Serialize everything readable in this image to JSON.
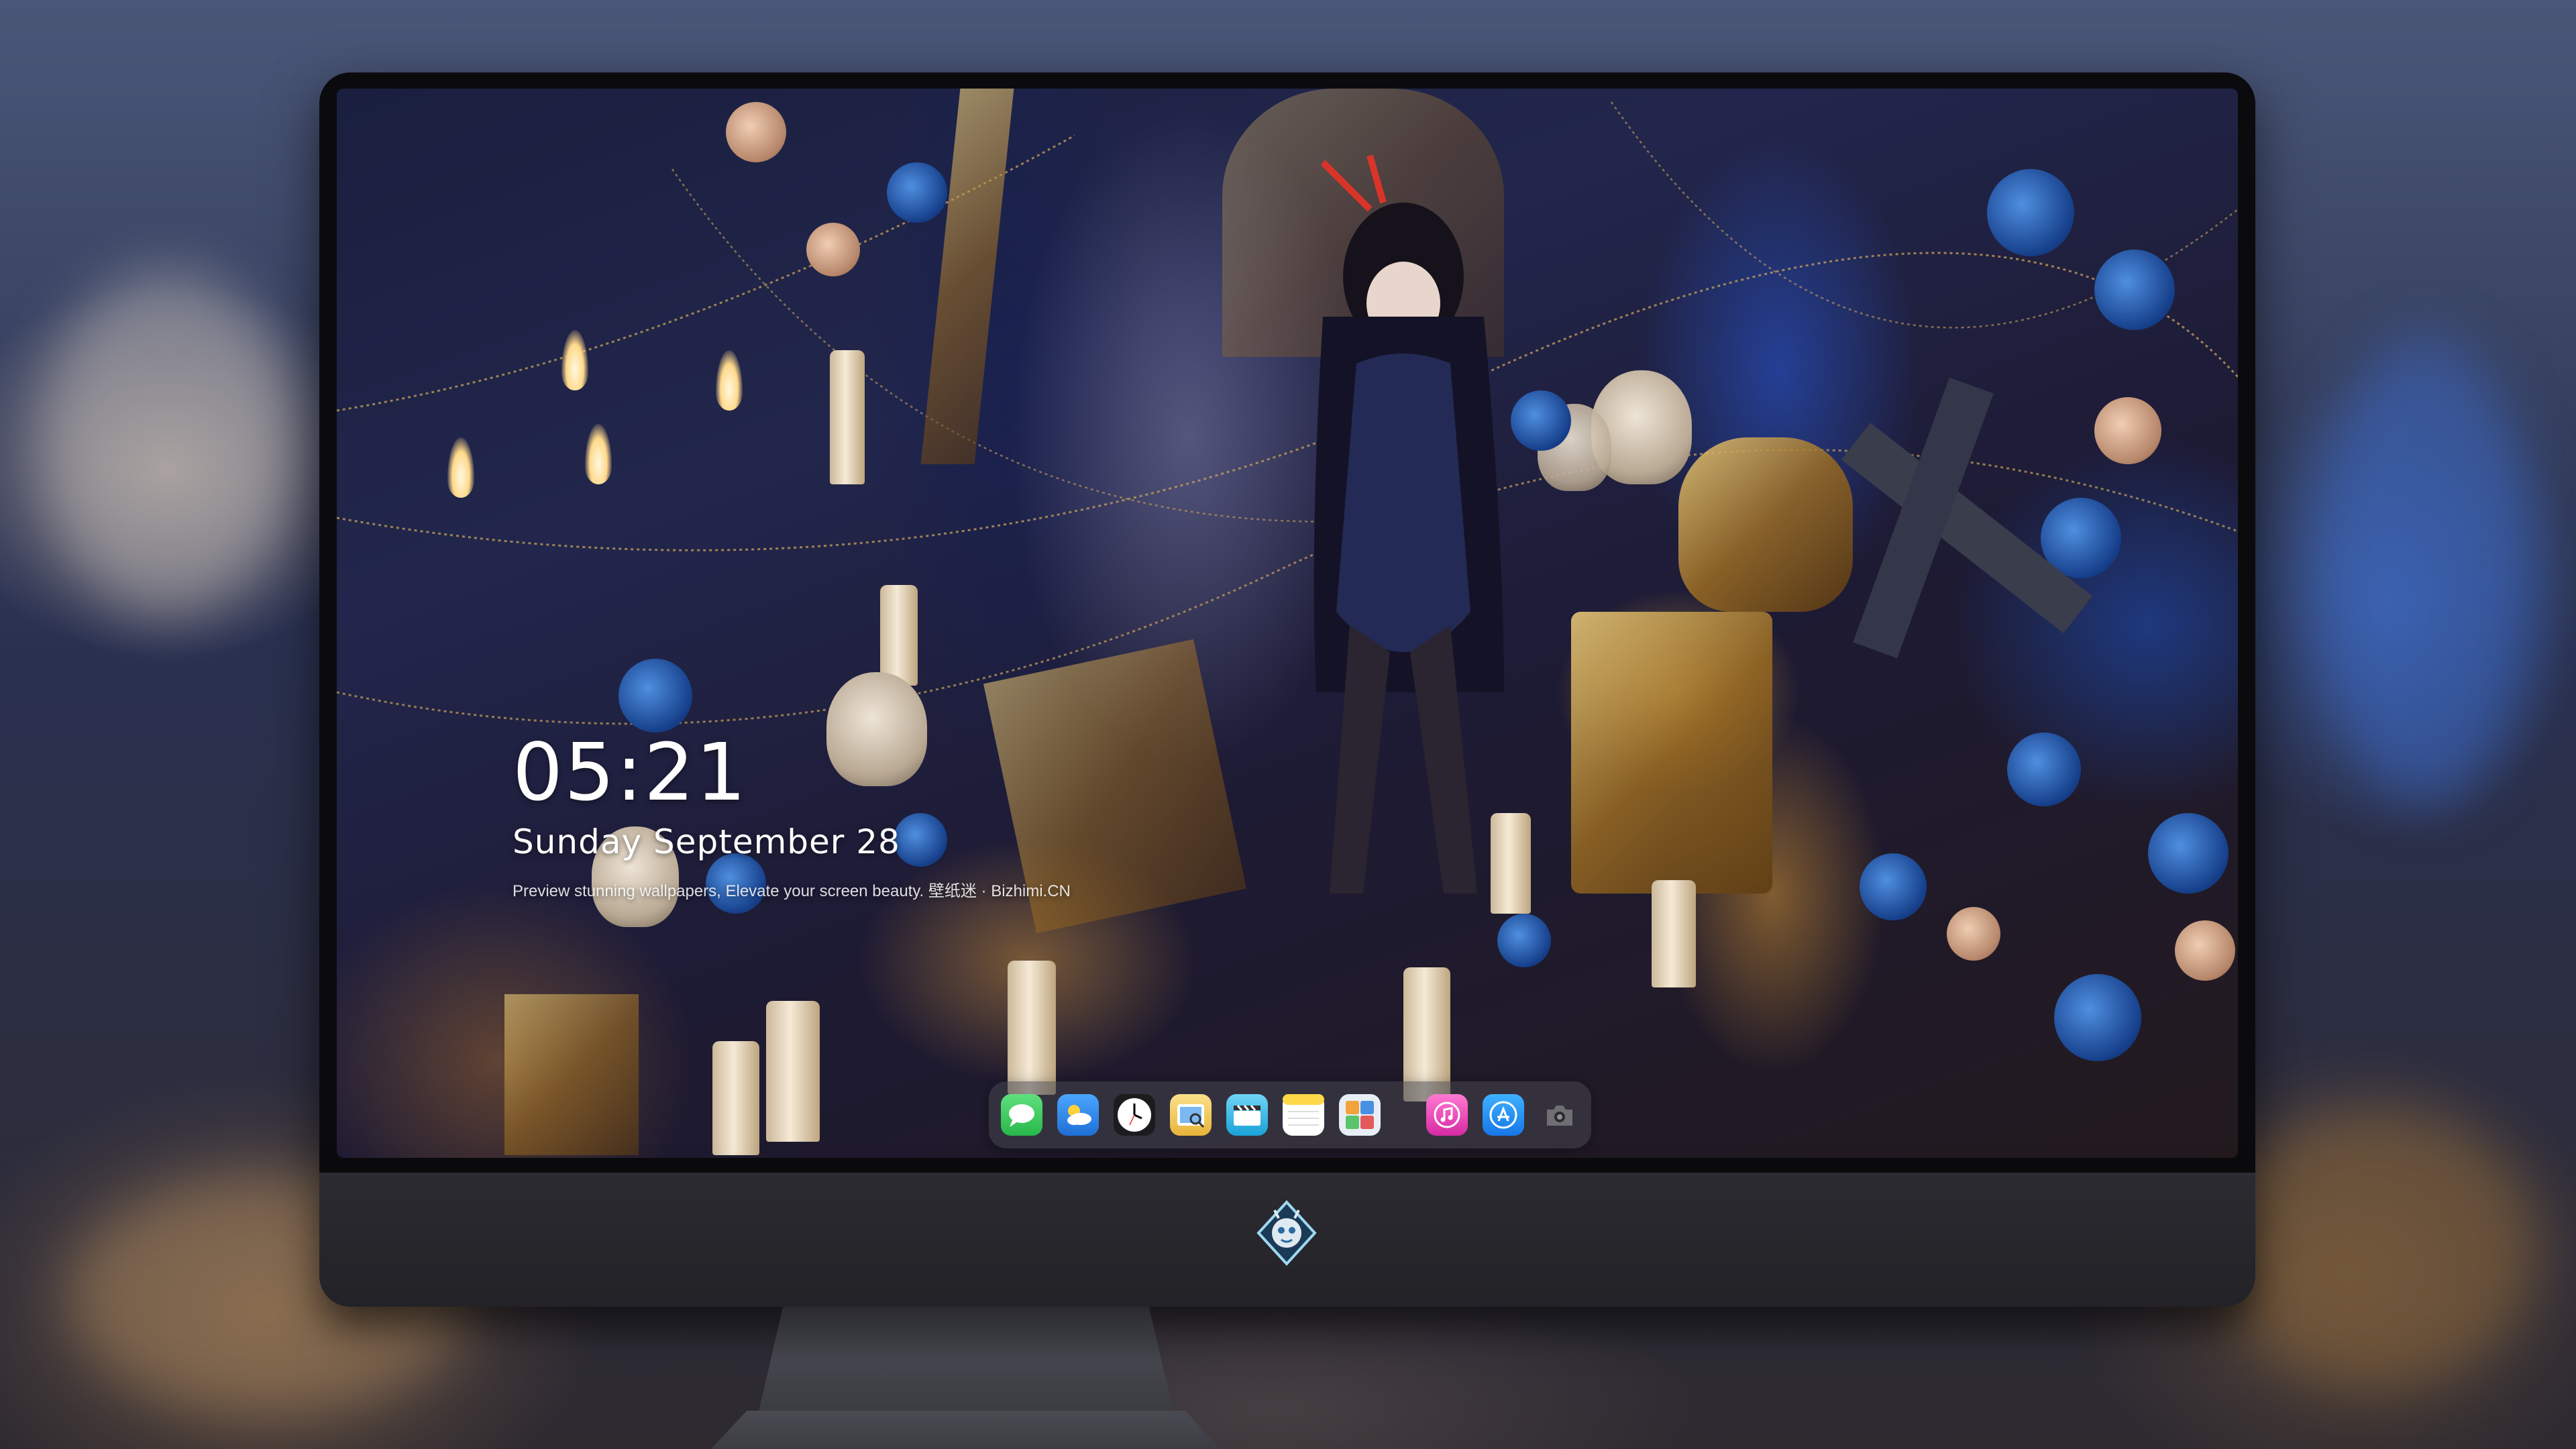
{
  "lockscreen": {
    "time": "05:21",
    "date": "Sunday September  28",
    "tagline": "Preview stunning wallpapers, Elevate your screen beauty. 壁纸迷 · Bizhimi.CN"
  },
  "dock": {
    "apps": [
      {
        "name": "messages-icon",
        "color": "#34c759"
      },
      {
        "name": "weather-icon",
        "color": "#2f8cf0"
      },
      {
        "name": "clock-icon",
        "color": "#ffffff"
      },
      {
        "name": "preview-icon",
        "color": "#f2c14e"
      },
      {
        "name": "clapper-icon",
        "color": "#39b8e6"
      },
      {
        "name": "notes-icon",
        "color": "#ffd84a"
      },
      {
        "name": "photos-folder-icon",
        "color": "#e8eef5"
      },
      {
        "name": "music-icon",
        "color": "#f04ca8"
      },
      {
        "name": "app-store-icon",
        "color": "#1e8ff5"
      },
      {
        "name": "camera-icon",
        "color": "#8e8e93"
      }
    ]
  },
  "monitor": {
    "logo": "dragon-badge-icon"
  }
}
